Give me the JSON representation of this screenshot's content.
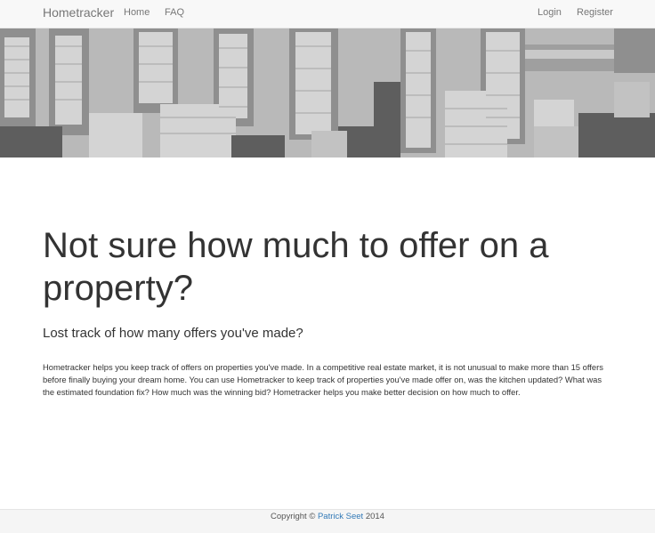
{
  "navbar": {
    "brand": "Hometracker",
    "left_links": [
      "Home",
      "FAQ"
    ],
    "right_links": [
      "Login",
      "Register"
    ]
  },
  "hero": {
    "image": "city-skyline-grayscale-photo"
  },
  "main": {
    "heading": "Not sure how much to offer on a property?",
    "subheading": "Lost track of how many offers you've made?",
    "body": "Hometracker helps you keep track of offers on properties you've made. In a competitive real estate market, it is not unusual to make more than 15 offers before finally buying your dream home. You can use Hometracker to keep track of properties you've made offer on, was the kitchen updated? What was the estimated foundation fix? How much was the winning bid? Hometracker helps you make better decision on how much to offer."
  },
  "footer": {
    "prefix": "Copyright © ",
    "author": "Patrick Seet",
    "suffix": " 2014"
  },
  "colors": {
    "navbar_bg": "#f8f8f8",
    "nav_text": "#777777",
    "link": "#337ab7",
    "text": "#333333"
  }
}
